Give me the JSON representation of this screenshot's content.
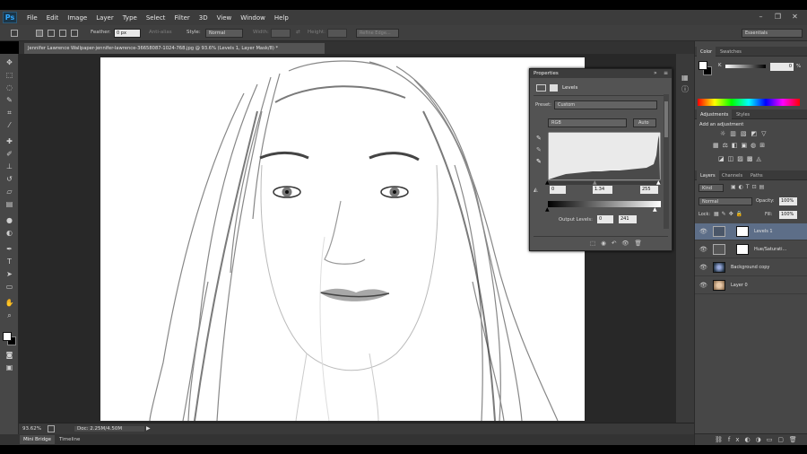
{
  "app": {
    "logo": "Ps"
  },
  "menu": [
    "File",
    "Edit",
    "Image",
    "Layer",
    "Type",
    "Select",
    "Filter",
    "3D",
    "View",
    "Window",
    "Help"
  ],
  "window_controls": {
    "minimize": "–",
    "restore": "❐",
    "close": "✕"
  },
  "options": {
    "feather_label": "Feather:",
    "feather_value": "0 px",
    "antialias_label": "Anti-alias",
    "style_label": "Style:",
    "style_value": "Normal",
    "width_label": "Width:",
    "height_label": "Height:",
    "refine_label": "Refine Edge...",
    "workspace": "Essentials"
  },
  "document": {
    "tab_title": "Jennifer Lawrence Wallpaper-jennifer-lawrence-36658087-1024-768.jpg @ 93.6% (Levels 1, Layer Mask/8) *",
    "tab_close": "×"
  },
  "status": {
    "zoom": "93.62%",
    "doc": "Doc: 2.25M/4.50M"
  },
  "bottom_tabs": [
    "Mini Bridge",
    "Timeline"
  ],
  "properties": {
    "title": "Properties",
    "subtitle": "Levels",
    "preset_label": "Preset:",
    "preset_value": "Custom",
    "channel": "RGB",
    "auto_label": "Auto",
    "input_black": "0",
    "input_gamma": "1.34",
    "input_white": "255",
    "output_label": "Output Levels:",
    "output_black": "0",
    "output_white": "241"
  },
  "color_panel": {
    "tabs": [
      "Color",
      "Swatches"
    ],
    "channel_label": "K",
    "value": "0",
    "unit": "%"
  },
  "adjustments_panel": {
    "tabs": [
      "Adjustments",
      "Styles"
    ],
    "heading": "Add an adjustment"
  },
  "layers_panel": {
    "tabs": [
      "Layers",
      "Channels",
      "Paths"
    ],
    "filter_kind": "Kind",
    "blend_mode": "Normal",
    "opacity_label": "Opacity:",
    "opacity_value": "100%",
    "lock_label": "Lock:",
    "fill_label": "Fill:",
    "fill_value": "100%",
    "layers": [
      {
        "name": "Levels 1",
        "selected": true
      },
      {
        "name": "Hue/Saturati...",
        "selected": false
      },
      {
        "name": "Background copy",
        "selected": false
      },
      {
        "name": "Layer 0",
        "selected": false
      }
    ]
  },
  "colors": {
    "menubar": "#3c3c3c",
    "panel": "#474747",
    "selection": "#5d6e88",
    "canvas_bg": "#282828"
  }
}
